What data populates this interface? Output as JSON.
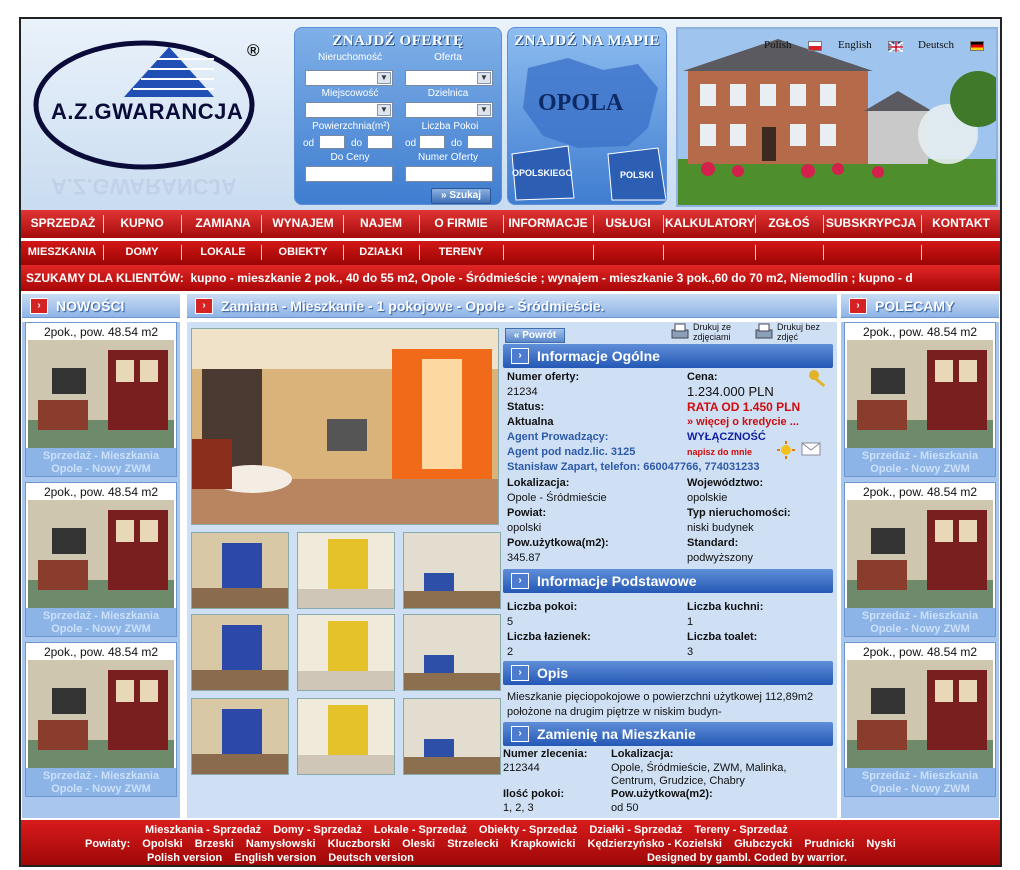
{
  "logo": {
    "text": "A.Z.GWARANCJA",
    "reg": "®"
  },
  "search": {
    "title": "ZNAJDŹ OFERTĘ",
    "nieruchomosc": "Nieruchomość",
    "oferta": "Oferta",
    "miejscowosc": "Miejscowość",
    "dzielnica": "Dzielnica",
    "powierzchnia": "Powierzchnia(m²)",
    "liczba_pokoi": "Liczba Pokoi",
    "od": "od",
    "do": "do",
    "do_ceny": "Do Ceny",
    "numer_oferty": "Numer Oferty",
    "button": "» Szukaj"
  },
  "map": {
    "title": "ZNAJDŹ NA MAPIE",
    "city": "OPOLA",
    "left": "OPOLSKIEGO",
    "right": "POLSKI"
  },
  "languages": [
    "Polish",
    "English",
    "Deutsch"
  ],
  "menu1": [
    "SPRZEDAŻ",
    "KUPNO",
    "ZAMIANA",
    "WYNAJEM",
    "NAJEM",
    "O FIRMIE",
    "INFORMACJE",
    "USŁUGI",
    "KALKULATORY",
    "ZGŁOŚ",
    "SUBSKRYPCJA",
    "KONTAKT"
  ],
  "menu2": [
    "MIESZKANIA",
    "DOMY",
    "LOKALE",
    "OBIEKTY",
    "DZIAŁKI",
    "TERENY"
  ],
  "ticker": {
    "label": "SZUKAMY DLA KLIENTÓW:",
    "text": "kupno - mieszkanie 2 pok., 40 do 55 m2, Opole - Śródmieście ; wynajem - mieszkanie 3 pok.,60 do 70 m2, Niemodlin ; kupno - d"
  },
  "left_col": {
    "title": "NOWOŚCI",
    "cards": [
      {
        "title": "2pok., pow. 48.54 m2",
        "line1": "Sprzedaż - Mieszkania",
        "line2": "Opole - Nowy ZWM"
      },
      {
        "title": "2pok., pow. 48.54 m2",
        "line1": "Sprzedaż - Mieszkania",
        "line2": "Opole - Nowy ZWM"
      },
      {
        "title": "2pok., pow. 48.54 m2",
        "line1": "Sprzedaż - Mieszkania",
        "line2": "Opole - Nowy ZWM"
      }
    ]
  },
  "right_col": {
    "title": "POLECAMY",
    "cards": [
      {
        "title": "2pok., pow. 48.54 m2",
        "line1": "Sprzedaż - Mieszkania",
        "line2": "Opole - Nowy ZWM"
      },
      {
        "title": "2pok., pow. 48.54 m2",
        "line1": "Sprzedaż - Mieszkania",
        "line2": "Opole - Nowy ZWM"
      },
      {
        "title": "2pok., pow. 48.54 m2",
        "line1": "Sprzedaż - Mieszkania",
        "line2": "Opole - Nowy ZWM"
      }
    ]
  },
  "center": {
    "title": "Zamiana - Mieszkanie - 1 pokojowe - Opole - Śródmieście.",
    "back": "« Powrót",
    "print1": "Drukuj ze zdjęciami",
    "print2": "Drukuj bez zdjęć",
    "sec1": "Informacje Ogólne",
    "numer_oferty_l": "Numer oferty:",
    "numer_oferty_v": "21234",
    "cena_l": "Cena:",
    "cena_v": "1.234.000 PLN",
    "rata": "RATA OD 1.450 PLN",
    "wiecej": "» więcej o kredycie ...",
    "status_l": "Status:",
    "status_v": "Aktualna",
    "agent_l": "Agent Prowadzący:",
    "wylacznosc": "WYŁĄCZNOŚĆ",
    "agent_lic": "Agent pod nadz.lic. 3125",
    "napisz": "napisz do mnie",
    "agent_name": "Stanisław Zapart, telefon: 660047766, 774031233",
    "lokalizacja_l": "Lokalizacja:",
    "lokalizacja_v": "Opole - Śródmieście",
    "wojewodztwo_l": "Województwo:",
    "wojewodztwo_v": "opolskie",
    "powiat_l": "Powiat:",
    "powiat_v": "opolski",
    "typ_l": "Typ nieruchomości:",
    "typ_v": "niski budynek",
    "pow_l": "Pow.użytkowa(m2):",
    "pow_v": "345.87",
    "standard_l": "Standard:",
    "standard_v": "podwyższony",
    "sec2": "Informacje Podstawowe",
    "pokoi_l": "Liczba pokoi:",
    "pokoi_v": "5",
    "kuchni_l": "Liczba kuchni:",
    "kuchni_v": "1",
    "lazienek_l": "Liczba łazienek:",
    "lazienek_v": "2",
    "toalet_l": "Liczba toalet:",
    "toalet_v": "3",
    "sec3": "Opis",
    "opis": "Mieszkanie pięciopokojowe o powierzchni użytkowej 112,89m2 położone na drugim piętrze w niskim budyn-",
    "sec4": "Zamienię na Mieszkanie",
    "zlecenia_l": "Numer zlecenia:",
    "zlecenia_v": "212344",
    "lok2_l": "Lokalizacja:",
    "lok2_v": "Opole, Śródmieście, ZWM, Malinka, Centrum, Grudzice, Chabry",
    "ilosc_l": "Ilość pokoi:",
    "ilosc_v": "1, 2, 3",
    "pow2_l": "Pow.użytkowa(m2):",
    "pow2_v": "od 50"
  },
  "footer": {
    "row1": [
      "Mieszkania - Sprzedaż",
      "Domy - Sprzedaż",
      "Lokale - Sprzedaż",
      "Obiekty - Sprzedaż",
      "Działki - Sprzedaż",
      "Tereny - Sprzedaż"
    ],
    "powiaty_label": "Powiaty:",
    "powiaty": [
      "Opolski",
      "Brzeski",
      "Namysłowski",
      "Kluczborski",
      "Oleski",
      "Strzelecki",
      "Krapkowicki",
      "Kędzierzyńsko - Kozielski",
      "Głubczycki",
      "Prudnicki",
      "Nyski"
    ],
    "row3": [
      "Polish version",
      "English version",
      "Deutsch version"
    ],
    "credits": "Designed by gambl. Coded by warrior."
  }
}
